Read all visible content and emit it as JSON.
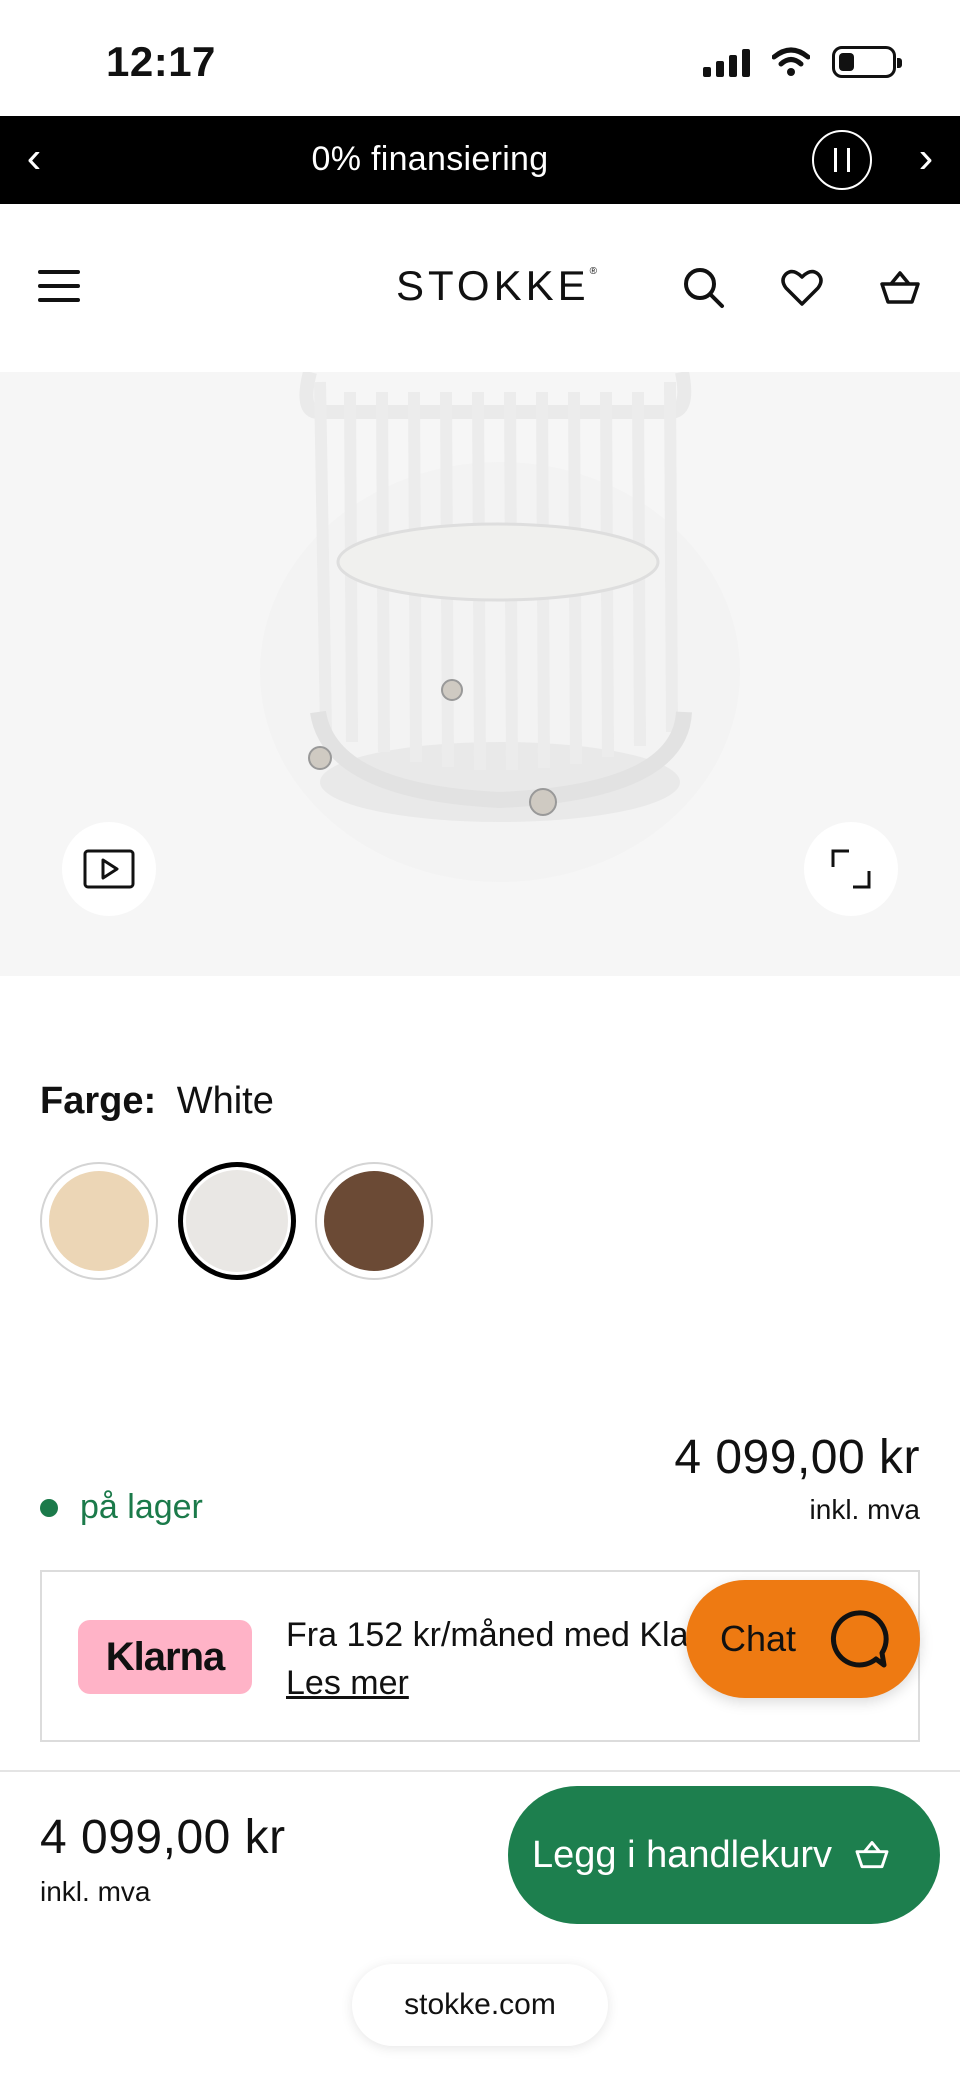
{
  "status_bar": {
    "time": "12:17"
  },
  "promo": {
    "text": "0% finansiering",
    "prev": "‹",
    "next": "›"
  },
  "header": {
    "logo": "STOKKE",
    "logo_mark": "®"
  },
  "product": {
    "color_label": "Farge:",
    "color_value": "White",
    "swatches": [
      {
        "name": "Natural",
        "color": "#ecd6b6",
        "selected": false
      },
      {
        "name": "White",
        "color": "#e9e7e4",
        "selected": true
      },
      {
        "name": "Walnut",
        "color": "#6b4a35",
        "selected": false
      }
    ],
    "stock": "på lager",
    "price": "4 099,00 kr",
    "vat": "inkl. mva"
  },
  "klarna": {
    "badge": "Klarna",
    "text": "Fra 152 kr/måned med Klarna",
    "link": "Les mer"
  },
  "chat": {
    "label": "Chat"
  },
  "sticky": {
    "price": "4 099,00 kr",
    "vat": "inkl. mva",
    "cart_label": "Legg i handlekurv"
  },
  "browser": {
    "url": "stokke.com"
  },
  "colors": {
    "promo_bg": "#000000",
    "accent_green": "#1d7f4e",
    "stock_green": "#1b7a4a",
    "chat_orange": "#ee7a12",
    "klarna_pink": "#ffb3c7"
  }
}
